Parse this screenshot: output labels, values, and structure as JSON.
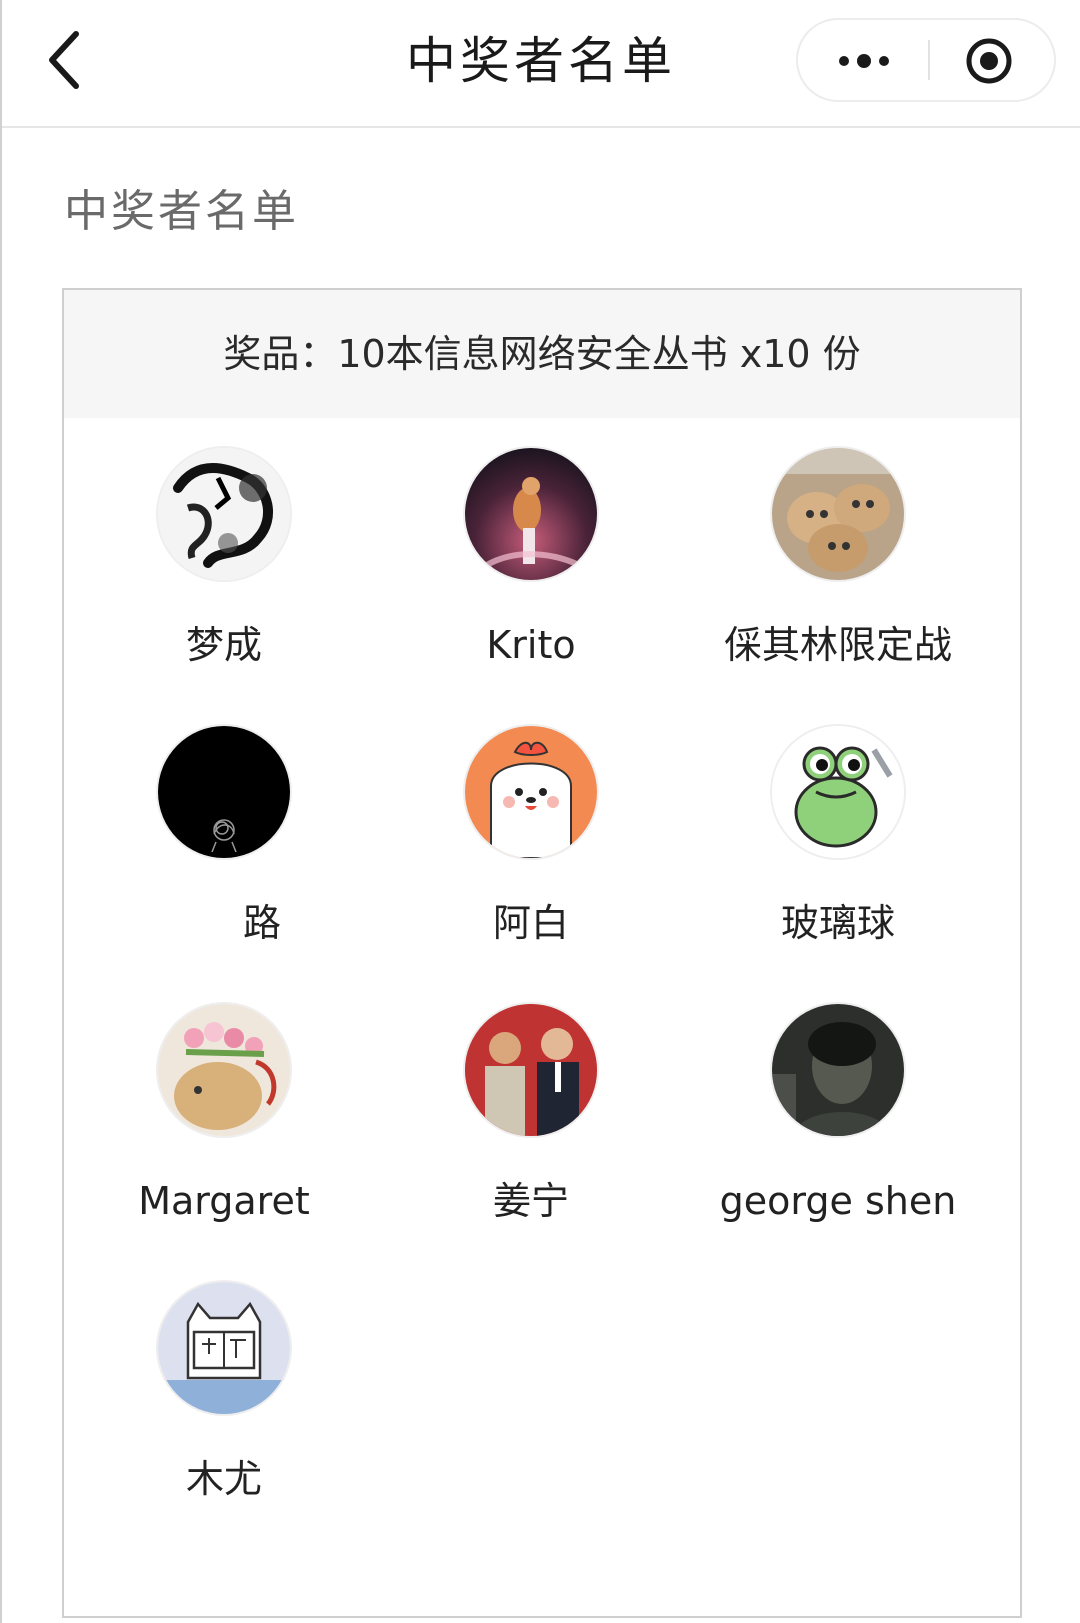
{
  "navbar": {
    "title": "中奖者名单",
    "back_icon": "chevron-left-icon",
    "more_icon": "more-dots-icon",
    "close_icon": "target-circle-icon"
  },
  "section": {
    "title": "中奖者名单"
  },
  "prize": {
    "text": "奖品：10本信息网络安全丛书 x10 份"
  },
  "winners": [
    {
      "name": "梦成",
      "avatar": "ink-art-avatar"
    },
    {
      "name": "Krito",
      "avatar": "anime-figure-avatar"
    },
    {
      "name": "倸其林限定战",
      "avatar": "cats-avatar"
    },
    {
      "name": "路",
      "avatar": "black-scribble-avatar"
    },
    {
      "name": "阿白",
      "avatar": "cartoon-dog-avatar"
    },
    {
      "name": "玻璃球",
      "avatar": "green-frog-avatar"
    },
    {
      "name": "Margaret",
      "avatar": "bunny-flowers-avatar"
    },
    {
      "name": "姜宁",
      "avatar": "two-men-photo-avatar"
    },
    {
      "name": "george shen",
      "avatar": "dark-portrait-avatar"
    },
    {
      "name": "木尤",
      "avatar": "cat-reading-avatar"
    }
  ],
  "colors": {
    "prize_bar_bg": "#f6f6f6",
    "card_border": "#cfcfcf",
    "section_title": "#6a6a6a"
  }
}
